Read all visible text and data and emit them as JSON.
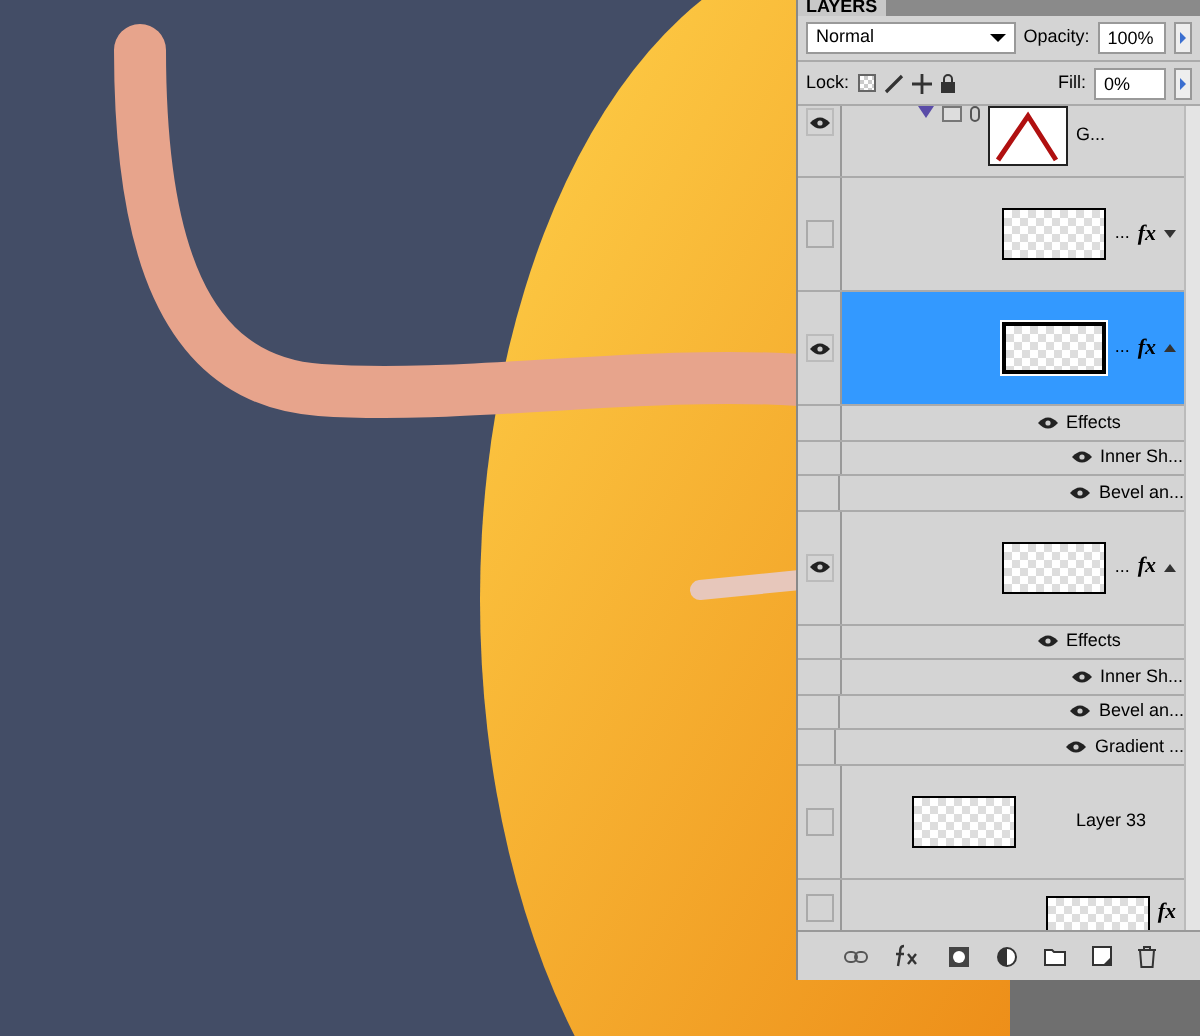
{
  "panel": {
    "tab": "LAYERS",
    "blend_mode": "Normal",
    "opacity_label": "Opacity:",
    "opacity": "100%",
    "lock_label": "Lock:",
    "fill_label": "Fill:",
    "fill": "0%"
  },
  "layers": [
    {
      "kind": "vector",
      "name": "G...",
      "visible": true,
      "selected": false
    },
    {
      "kind": "pixel",
      "name": "...",
      "fx": "fx",
      "visible": false,
      "selected": false,
      "expanded": false
    },
    {
      "kind": "pixel",
      "name": "...",
      "fx": "fx",
      "visible": true,
      "selected": true,
      "expanded": true,
      "effects_label": "Effects",
      "effects": [
        {
          "name": "Inner Sh...",
          "visible": true
        },
        {
          "name": "Bevel an...",
          "visible": true
        }
      ]
    },
    {
      "kind": "pixel",
      "name": "...",
      "fx": "fx",
      "visible": true,
      "selected": false,
      "expanded": true,
      "effects_label": "Effects",
      "effects": [
        {
          "name": "Inner Sh...",
          "visible": true
        },
        {
          "name": "Bevel an...",
          "visible": true
        },
        {
          "name": "Gradient ...",
          "visible": true
        }
      ]
    },
    {
      "kind": "pixel",
      "name": "Layer 33",
      "visible": false,
      "selected": false
    },
    {
      "kind": "pixel",
      "fx": "fx",
      "visible": false,
      "selected": false
    }
  ]
}
